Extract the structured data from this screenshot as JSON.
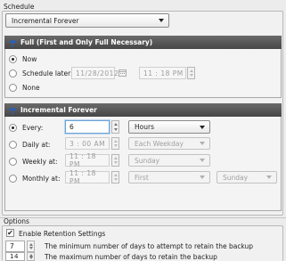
{
  "schedule": {
    "section_label": "Schedule",
    "mode_selected": "Incremental Forever"
  },
  "full_panel": {
    "title": "Full (First and Only Full Necessary)",
    "options": [
      {
        "label": "Now",
        "checked": true
      },
      {
        "label": "Schedule later:",
        "checked": false
      },
      {
        "label": "None",
        "checked": false
      }
    ],
    "date_value": "11/28/2012",
    "time_value": "11 : 18  PM"
  },
  "incremental_panel": {
    "title": "Incremental Forever",
    "rows": [
      {
        "label": "Every:",
        "checked": true,
        "value": "6",
        "unit": "Hours"
      },
      {
        "label": "Daily at:",
        "checked": false,
        "value": "3 : 00  AM",
        "unit": "Each Weekday"
      },
      {
        "label": "Weekly at:",
        "checked": false,
        "value": "11 : 18  PM",
        "unit": "Sunday"
      },
      {
        "label": "Monthly at:",
        "checked": false,
        "value": "11 : 18  PM",
        "unit": "First",
        "unit2": "Sunday"
      }
    ]
  },
  "options": {
    "section_label": "Options",
    "retention_label": "Enable Retention Settings",
    "retention_checked": true,
    "attempt_days_value": "7",
    "attempt_days_label": "The minimum number of days to attempt to retain the backup",
    "max_days_value": "14",
    "max_days_label": "The maximum number of days to retain the backup"
  },
  "colors": {
    "panel_header": "#555555",
    "accent_umbrella": "#2b5fb8"
  }
}
